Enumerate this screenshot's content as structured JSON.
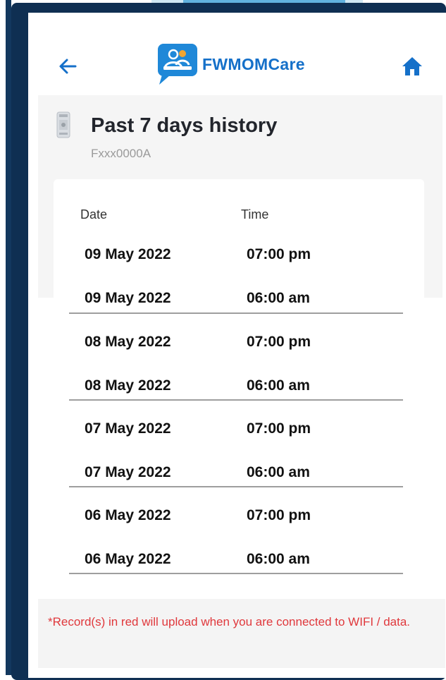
{
  "app": {
    "brand": "FWMOMCare"
  },
  "icons": {
    "back": "arrow-left-icon",
    "home": "home-icon",
    "logo": "fwmomcare-logo-icon",
    "device": "device-card-icon"
  },
  "colors": {
    "brand": "#1570c9",
    "notice": "#e0383c",
    "frame": "#0f2f52"
  },
  "page": {
    "title": "Past 7 days history",
    "subtitle": "Fxxx0000A"
  },
  "table": {
    "headers": {
      "date": "Date",
      "time": "Time"
    },
    "rows": [
      {
        "date": "09 May 2022",
        "time": "07:00 pm"
      },
      {
        "date": "09 May 2022",
        "time": "06:00 am"
      },
      {
        "date": "08 May 2022",
        "time": "07:00 pm"
      },
      {
        "date": "08 May 2022",
        "time": "06:00 am"
      },
      {
        "date": "07 May 2022",
        "time": "07:00 pm"
      },
      {
        "date": "07 May 2022",
        "time": "06:00 am"
      },
      {
        "date": "06 May 2022",
        "time": "07:00 pm"
      },
      {
        "date": "06 May 2022",
        "time": "06:00 am"
      }
    ]
  },
  "notice": "*Record(s) in red will upload when you are connected to WIFI / data."
}
